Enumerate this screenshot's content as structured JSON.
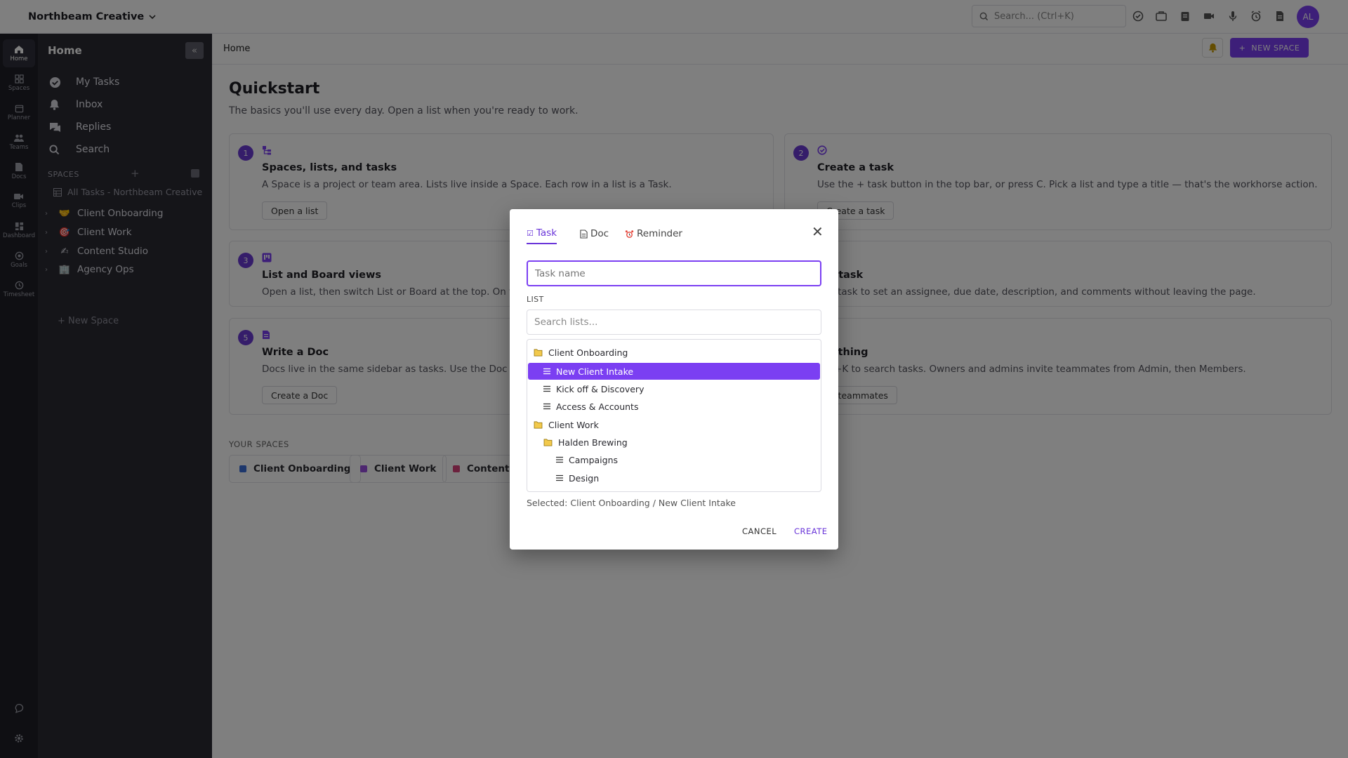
{
  "workspace": {
    "name": "Northbeam Creative"
  },
  "topbar": {
    "search_placeholder": "Search... (Ctrl+K)",
    "avatar_initials": "AL"
  },
  "rail": {
    "items": [
      "Home",
      "Spaces",
      "Planner",
      "Teams",
      "Docs",
      "Clips",
      "Dashboard",
      "Goals",
      "Timesheet"
    ]
  },
  "sidebar": {
    "title": "Home",
    "nav": [
      "My Tasks",
      "Inbox",
      "Replies",
      "Search"
    ],
    "spaces_label": "SPACES",
    "all_tasks": "All Tasks - Northbeam Creative",
    "spaces": [
      {
        "name": "Client Onboarding",
        "emoji": "🤝"
      },
      {
        "name": "Client Work",
        "emoji": "🎯"
      },
      {
        "name": "Content Studio",
        "emoji": "✍"
      },
      {
        "name": "Agency Ops",
        "emoji": "🏢"
      }
    ],
    "new_space": "+ New Space"
  },
  "main": {
    "breadcrumb": "Home",
    "new_space_button": "NEW SPACE",
    "title": "Quickstart",
    "subtitle": "The basics you'll use every day. Open a list when you're ready to work.",
    "cards": [
      {
        "num": "1",
        "title": "Spaces, lists, and tasks",
        "desc": "A Space is a project or team area. Lists live inside a Space. Each row in a list is a Task.",
        "button": "Open a list"
      },
      {
        "num": "2",
        "title": "Create a task",
        "desc": "Use the + task button in the top bar, or press C. Pick a list and type a title — that's the workhorse action.",
        "button": "Create a task"
      },
      {
        "num": "3",
        "title": "List and Board views",
        "desc": "Open a list, then switch List or Board at the top. On the",
        "button": ""
      },
      {
        "num": "4",
        "title": "n a task",
        "desc": "any task to set an assignee, due date, description, and comments without leaving the page.",
        "button": ""
      },
      {
        "num": "5",
        "title": "Write a Doc",
        "desc": "Docs live in the same sidebar as tasks. Use the Doc butt",
        "button": "Create a Doc"
      },
      {
        "num": "6",
        "title": "anything",
        "desc": "Ctrl+K to search tasks. Owners and admins invite teammates from Admin, then Members.",
        "button": "te teammates"
      }
    ],
    "your_spaces_label": "YOUR SPACES",
    "your_spaces": [
      {
        "name": "Client Onboarding",
        "color": "#3b6fd9"
      },
      {
        "name": "Client Work",
        "color": "#9b4fe0"
      },
      {
        "name": "Content S",
        "color": "#d9437a"
      }
    ]
  },
  "modal": {
    "tabs": [
      "Task",
      "Doc",
      "Reminder"
    ],
    "task_name_placeholder": "Task name",
    "list_label": "LIST",
    "list_search_placeholder": "Search lists...",
    "tree": [
      {
        "label": "Client Onboarding",
        "type": "folder",
        "level": 0
      },
      {
        "label": "New Client Intake",
        "type": "list",
        "level": 1,
        "selected": true
      },
      {
        "label": "Kick off & Discovery",
        "type": "list",
        "level": 1
      },
      {
        "label": "Access & Accounts",
        "type": "list",
        "level": 1
      },
      {
        "label": "Client Work",
        "type": "folder",
        "level": 0
      },
      {
        "label": "Halden Brewing",
        "type": "folder",
        "level": 1
      },
      {
        "label": "Campaigns",
        "type": "list",
        "level": 2
      },
      {
        "label": "Design",
        "type": "list",
        "level": 2
      }
    ],
    "selected_text": "Selected: Client Onboarding / New Client Intake",
    "cancel": "CANCEL",
    "create": "CREATE",
    "accent": "#7b3ff2"
  }
}
